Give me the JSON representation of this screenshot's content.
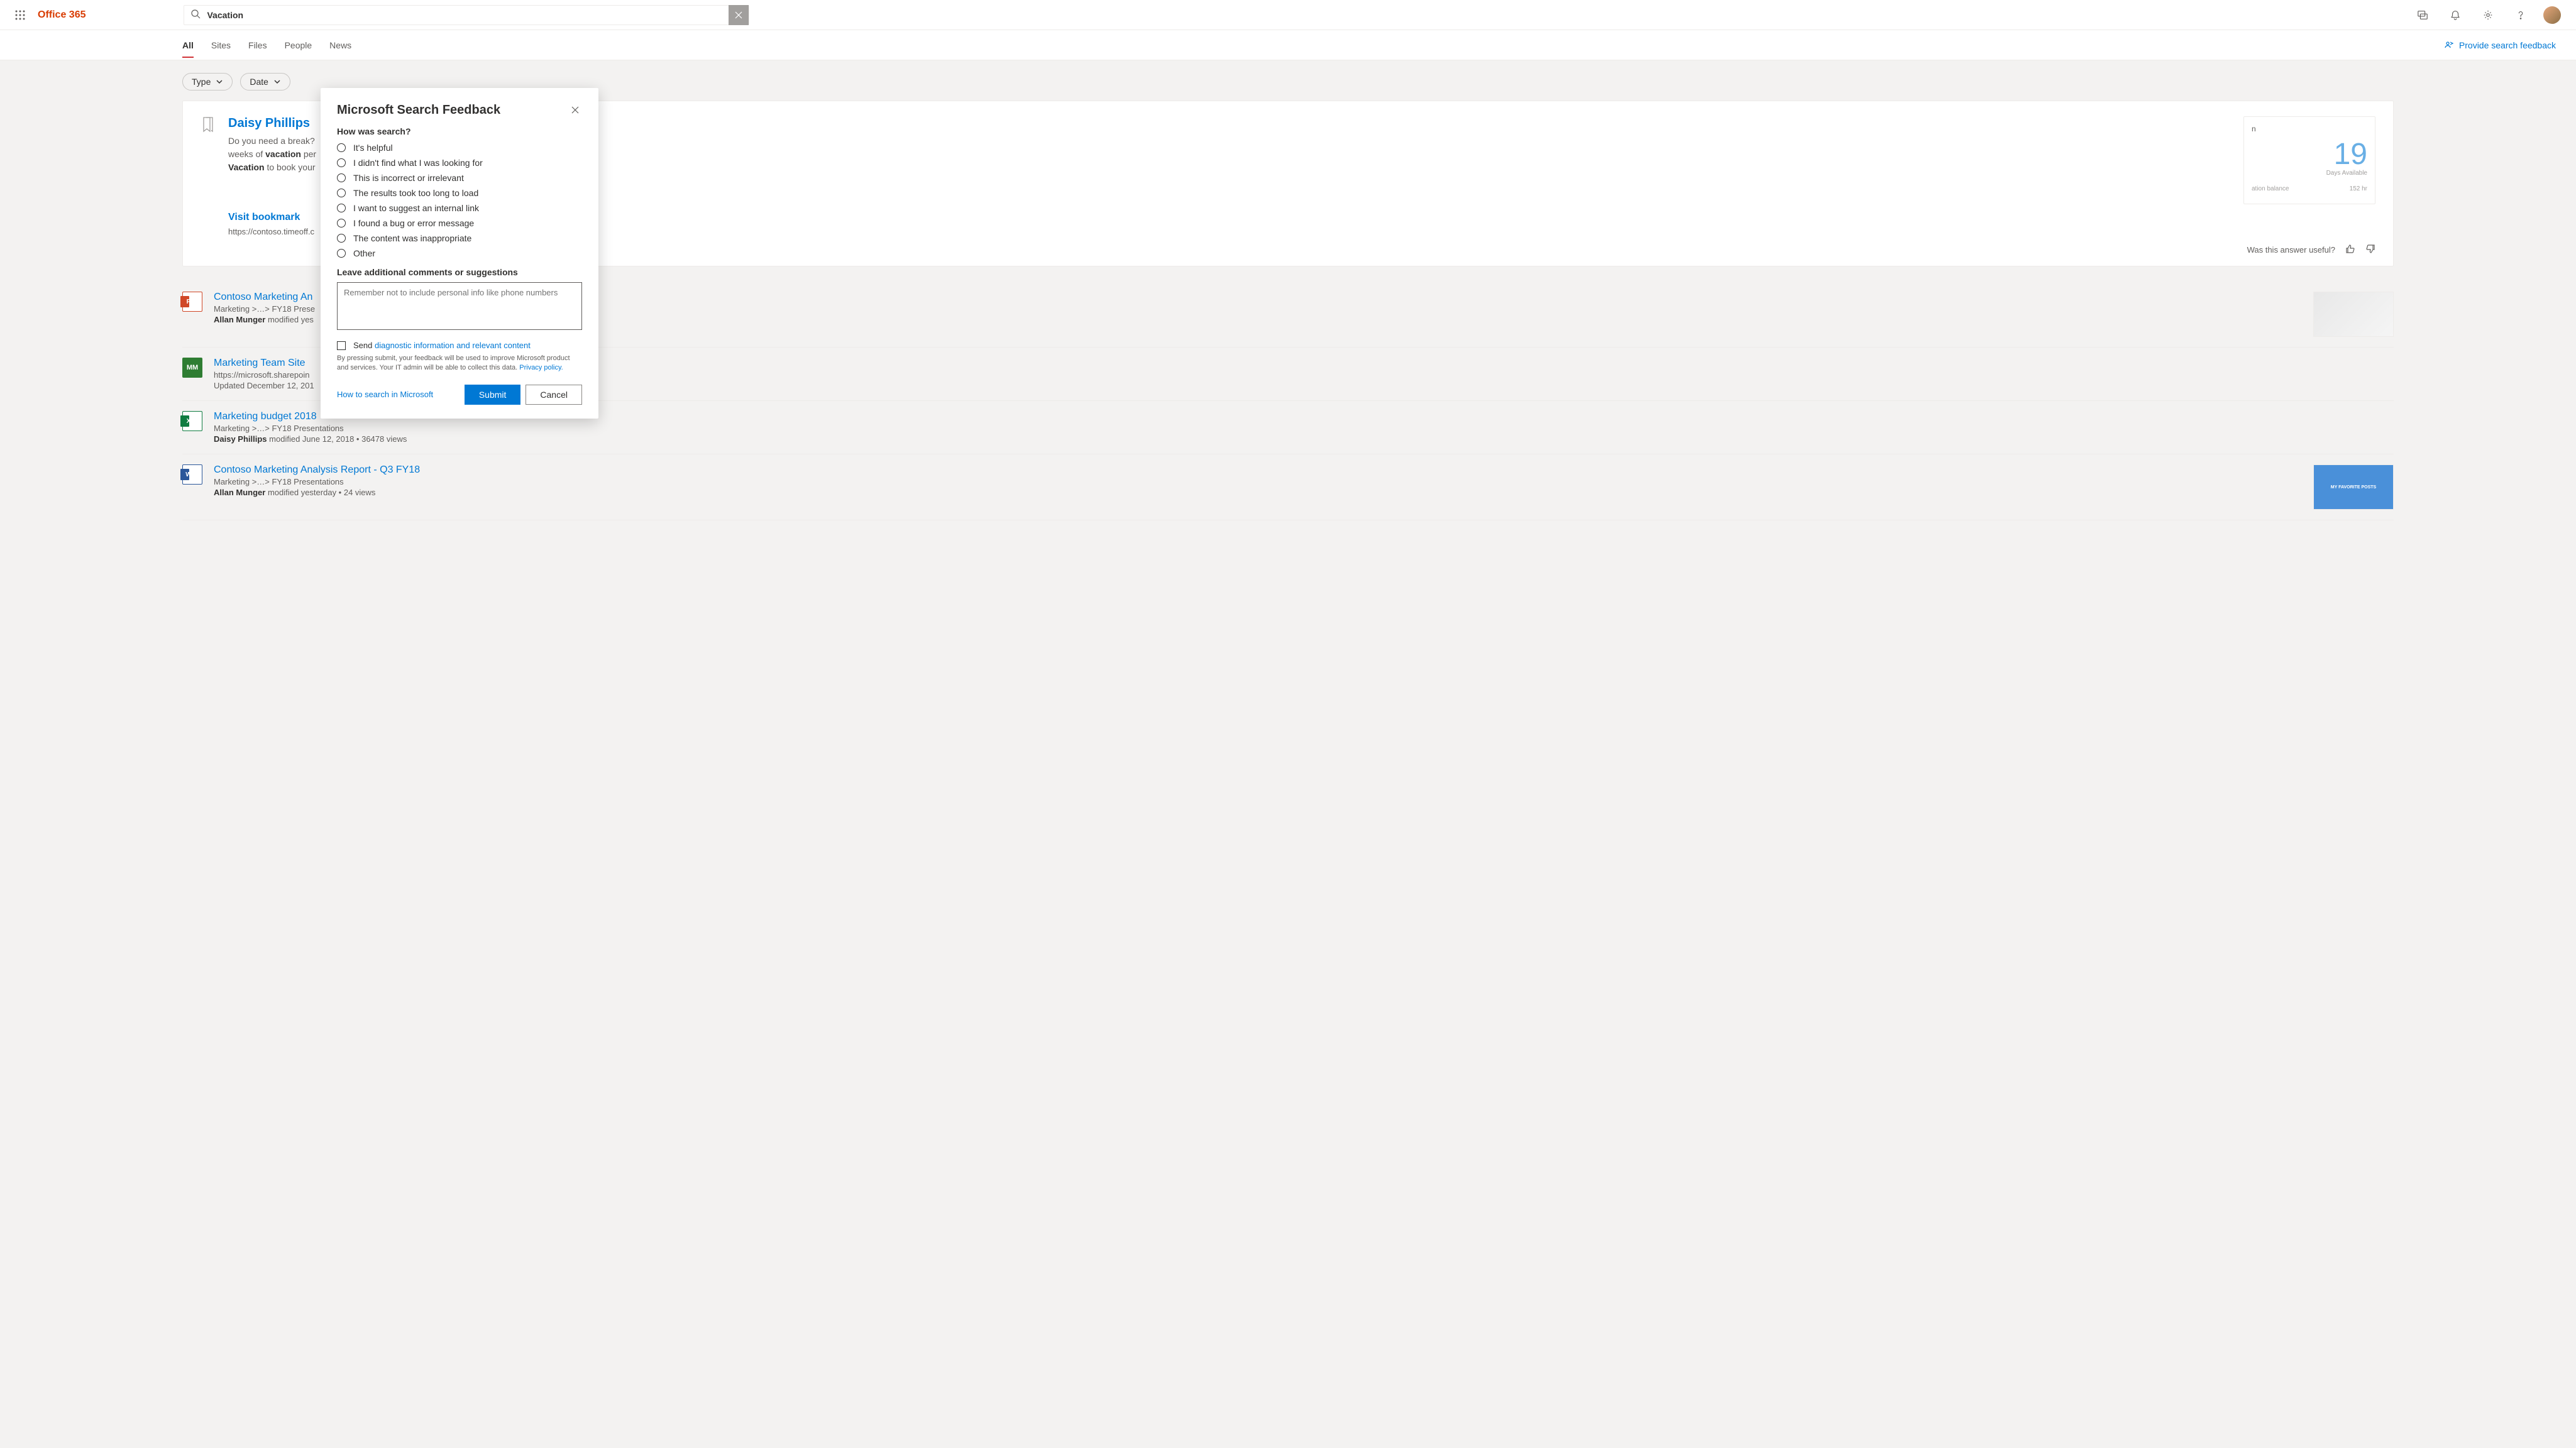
{
  "header": {
    "app_name": "Office 365",
    "search_value": "Vacation",
    "icons": {
      "search": "search",
      "clear": "close",
      "chat": "chat",
      "bell": "bell",
      "gear": "gear",
      "help": "help"
    }
  },
  "tabs": {
    "items": [
      {
        "label": "All",
        "active": true
      },
      {
        "label": "Sites",
        "active": false
      },
      {
        "label": "Files",
        "active": false
      },
      {
        "label": "People",
        "active": false
      },
      {
        "label": "News",
        "active": false
      }
    ],
    "feedback_link": "Provide search feedback"
  },
  "filters": [
    {
      "label": "Type"
    },
    {
      "label": "Date"
    }
  ],
  "answer": {
    "title": "Daisy Phillips",
    "desc_prefix": "Do you need a break?",
    "desc_mid": "weeks of",
    "desc_bold1": "vacation",
    "desc_suffix1": "per",
    "desc_bold2": "Vacation",
    "desc_suffix2": "to book your",
    "visit_label": "Visit bookmark",
    "url": "https://contoso.timeoff.c",
    "widget": {
      "title_suffix": "n",
      "big_number": "19",
      "big_label": "Days Available",
      "row1_label": "ation balance",
      "row1_value": "152  hr"
    },
    "useful_label": "Was this answer useful?"
  },
  "results": [
    {
      "icon": "ppt",
      "icon_text": "P",
      "title": "Contoso Marketing An",
      "path": "Marketing >…> FY18 Prese",
      "meta_author": "Allan Munger",
      "meta_action": "modified yes",
      "has_thumb": true,
      "thumb_style": "light"
    },
    {
      "icon": "site",
      "icon_text": "MM",
      "title": "Marketing Team Site",
      "path": "https://microsoft.sharepoin",
      "meta_plain": "Updated December 12, 201",
      "has_thumb": false
    },
    {
      "icon": "xls",
      "icon_text": "X",
      "title": "Marketing budget 2018",
      "path": "Marketing >…> FY18 Presentations",
      "meta_author": "Daisy Phillips",
      "meta_action": "modified June 12, 2018  •  36478 views",
      "has_thumb": false
    },
    {
      "icon": "doc",
      "icon_text": "W",
      "title": "Contoso Marketing Analysis Report - Q3 FY18",
      "path": "Marketing >…> FY18 Presentations",
      "meta_author": "Allan Munger",
      "meta_action": "modified yesterday  •  24 views",
      "has_thumb": true,
      "thumb_style": "blue",
      "thumb_text": "MY FAVORITE POSTS"
    }
  ],
  "modal": {
    "title": "Microsoft Search Feedback",
    "question": "How was search?",
    "options": [
      "It's helpful",
      "I didn't find what I was looking for",
      "This is incorrect or irrelevant",
      "The results took too long to load",
      "I want to suggest an internal link",
      "I found a bug or error message",
      "The content was inappropriate",
      "Other"
    ],
    "comments_label": "Leave additional comments or suggestions",
    "comments_placeholder": "Remember not to include personal info like phone numbers",
    "send_prefix": "Send",
    "send_link": "diagnostic information and relevant content",
    "fine_print": "By pressing submit, your feedback will be used to improve Microsoft product and services. Your IT admin will be able to collect this data.",
    "privacy_link": "Privacy policy.",
    "howto_link": "How to search in Microsoft",
    "submit_label": "Submit",
    "cancel_label": "Cancel"
  }
}
